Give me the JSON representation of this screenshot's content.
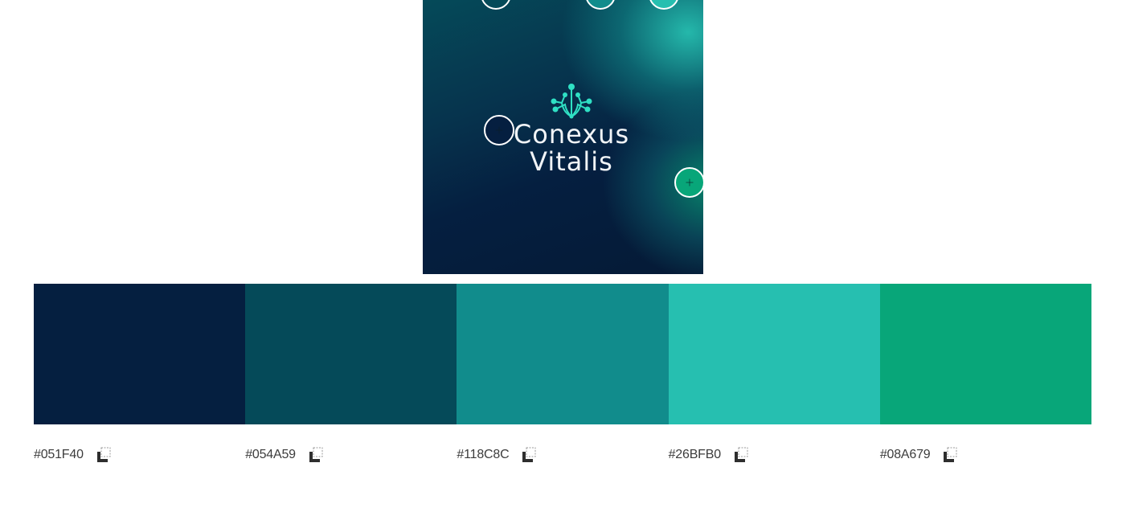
{
  "preview": {
    "logo_line1": "Conexus",
    "logo_line2": "Vitalis"
  },
  "handles": [
    {
      "name": "color-picker-handle-1",
      "color": "#051F40"
    },
    {
      "name": "color-picker-handle-2",
      "color": "#054A59"
    },
    {
      "name": "color-picker-handle-3",
      "color": "#118C8C"
    },
    {
      "name": "color-picker-handle-4",
      "color": "#26BFB0"
    },
    {
      "name": "color-picker-handle-5",
      "color": "#08A679"
    }
  ],
  "swatches": [
    {
      "hex": "#051F40",
      "color": "#051F40",
      "copy_icon": "copy-icon"
    },
    {
      "hex": "#054A59",
      "color": "#054A59",
      "copy_icon": "copy-icon"
    },
    {
      "hex": "#118C8C",
      "color": "#118C8C",
      "copy_icon": "copy-icon"
    },
    {
      "hex": "#26BFB0",
      "color": "#26BFB0",
      "copy_icon": "copy-icon"
    },
    {
      "hex": "#08A679",
      "color": "#08A679",
      "copy_icon": "copy-icon"
    }
  ]
}
